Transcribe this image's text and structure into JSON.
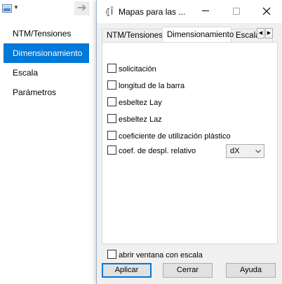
{
  "left_panel": {
    "toolbar": {
      "picture_icon": "picture-icon",
      "dropdown_icon": "caret-down-icon",
      "forward_icon": "arrow-right-icon"
    },
    "nav_items": [
      {
        "label": "NTM/Tensiones",
        "selected": false
      },
      {
        "label": "Dimensionamiento",
        "selected": true
      },
      {
        "label": "Escala",
        "selected": false
      },
      {
        "label": "Parámetros",
        "selected": false
      }
    ]
  },
  "dialog": {
    "title": "Mapas para las ...",
    "app_icon_glyph": "⦃Ĩ",
    "tabs": [
      {
        "label": "NTM/Tensiones",
        "active": false
      },
      {
        "label": "Dimensionamiento",
        "active": true
      },
      {
        "label": "Escala",
        "active": false
      }
    ],
    "checkboxes": [
      {
        "label": "solicitación",
        "checked": false
      },
      {
        "label": "longitud de la barra",
        "checked": false
      },
      {
        "label": "esbeltez Lay",
        "checked": false
      },
      {
        "label": "esbeltez Laz",
        "checked": false
      },
      {
        "label": "coeficiente de utilización plástico",
        "checked": false
      },
      {
        "label": "coef. de despl. relativo",
        "checked": false
      }
    ],
    "select": {
      "value": "dX"
    },
    "bottom_checkbox": {
      "label": "abrir ventana con escala",
      "checked": false
    },
    "buttons": {
      "apply": "Aplicar",
      "close": "Cerrar",
      "help": "Ayuda"
    },
    "colors": {
      "accent": "#0078d7",
      "dialog_bg": "#f0f0f0"
    }
  }
}
